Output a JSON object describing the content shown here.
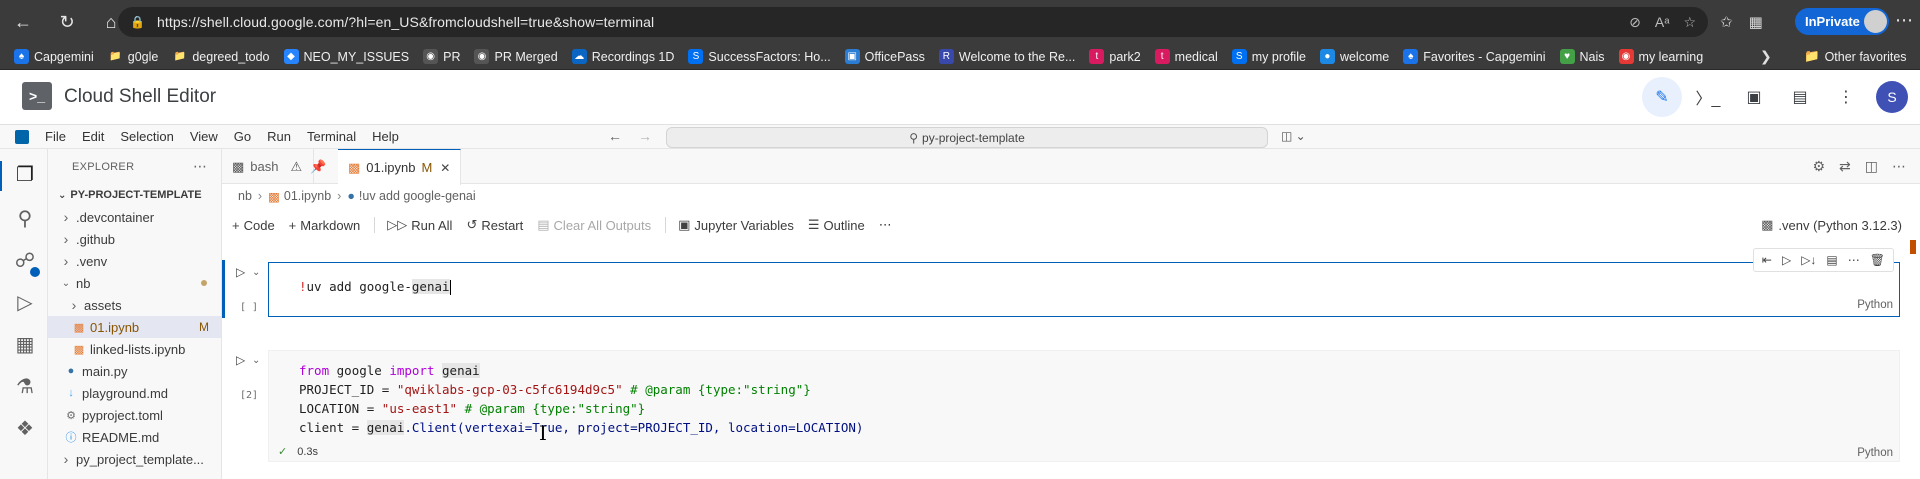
{
  "browser": {
    "url": "https://shell.cloud.google.com/?hl=en_US&fromcloudshell=true&show=terminal",
    "inprivate_label": "InPrivate",
    "bookmarks": [
      {
        "label": "Capgemini",
        "icon": "spade-icon",
        "color": "#1a73e8"
      },
      {
        "label": "g0gle",
        "icon": "folder-icon",
        "color": "#777777"
      },
      {
        "label": "degreed_todo",
        "icon": "folder-icon",
        "color": "#777777"
      },
      {
        "label": "NEO_MY_ISSUES",
        "icon": "diamond-icon",
        "color": "#2684ff"
      },
      {
        "label": "PR",
        "icon": "github-icon",
        "color": "#555555"
      },
      {
        "label": "PR Merged",
        "icon": "github-icon",
        "color": "#555555"
      },
      {
        "label": "Recordings 1D",
        "icon": "cloud-icon",
        "color": "#0a66c2"
      },
      {
        "label": "SuccessFactors: Ho...",
        "icon": "sf-icon",
        "color": "#0070f2"
      },
      {
        "label": "OfficePass",
        "icon": "pass-icon",
        "color": "#2b7cd3"
      },
      {
        "label": "Welcome to the Re...",
        "icon": "r-icon",
        "color": "#3949ab"
      },
      {
        "label": "park2",
        "icon": "t-icon",
        "color": "#d81b60"
      },
      {
        "label": "medical",
        "icon": "t-icon",
        "color": "#d81b60"
      },
      {
        "label": "my profile",
        "icon": "sf-icon",
        "color": "#0070f2"
      },
      {
        "label": "welcome",
        "icon": "globe-icon",
        "color": "#1e88e5"
      },
      {
        "label": "Favorites - Capgemini",
        "icon": "spade-icon",
        "color": "#1a73e8"
      },
      {
        "label": "Nais",
        "icon": "heart-icon",
        "color": "#43a047"
      },
      {
        "label": "my learning",
        "icon": "learning-icon",
        "color": "#e53935"
      }
    ],
    "other_favorites": "Other favorites"
  },
  "cloudshell": {
    "title": "Cloud Shell Editor",
    "avatar_letter": "S"
  },
  "menubar": {
    "items": [
      "File",
      "Edit",
      "Selection",
      "View",
      "Go",
      "Run",
      "Terminal",
      "Help"
    ],
    "search_text": "py-project-template"
  },
  "explorer": {
    "header": "EXPLORER",
    "root": "PY-PROJECT-TEMPLATE",
    "items": [
      {
        "label": ".devcontainer",
        "kind": "folder",
        "indent": 1,
        "expanded": false
      },
      {
        "label": ".github",
        "kind": "folder",
        "indent": 1,
        "expanded": false
      },
      {
        "label": ".venv",
        "kind": "folder",
        "indent": 1,
        "expanded": false
      },
      {
        "label": "nb",
        "kind": "folder",
        "indent": 1,
        "expanded": true,
        "modified_dot": true
      },
      {
        "label": "assets",
        "kind": "folder",
        "indent": 2,
        "expanded": false
      },
      {
        "label": "01.ipynb",
        "kind": "notebook",
        "indent": 2,
        "selected": true,
        "status": "M"
      },
      {
        "label": "linked-lists.ipynb",
        "kind": "notebook",
        "indent": 2
      },
      {
        "label": "main.py",
        "kind": "python",
        "indent": 1
      },
      {
        "label": "playground.md",
        "kind": "markdown",
        "indent": 1
      },
      {
        "label": "pyproject.toml",
        "kind": "toml",
        "indent": 1
      },
      {
        "label": "README.md",
        "kind": "info",
        "indent": 1
      },
      {
        "label": "py_project_template...",
        "kind": "folder",
        "indent": 1,
        "expanded": false
      }
    ]
  },
  "tabs": [
    {
      "label": "bash",
      "icon": "terminal-icon",
      "active": false
    },
    {
      "label": "01.ipynb",
      "icon": "notebook-icon",
      "active": true,
      "status": "M"
    }
  ],
  "breadcrumb": [
    "nb",
    "01.ipynb",
    "!uv add google-genai"
  ],
  "toolbar": {
    "code": "Code",
    "markdown": "Markdown",
    "run_all": "Run All",
    "restart": "Restart",
    "clear_outputs": "Clear All Outputs",
    "variables": "Jupyter Variables",
    "outline": "Outline",
    "kernel": ".venv (Python 3.12.3)"
  },
  "cells": [
    {
      "exec_count": "[ ]",
      "language": "Python",
      "code": "!uv add google-genai"
    },
    {
      "exec_count": "[2]",
      "language": "Python",
      "line1_kw": "from",
      "line1_mod": "google",
      "line1_kw2": "import",
      "line1_name": "genai",
      "line2_var": "PROJECT_ID",
      "line2_str": "\"qwiklabs-gcp-03-c5fc6194d9c5\"",
      "line2_cmt": "# @param {type:\"string\"}",
      "line3_var": "LOCATION",
      "line3_str": "\"us-east1\"",
      "line3_cmt": "# @param {type:\"string\"}",
      "line4_a": "client = ",
      "line4_b": "genai",
      "line4_c": ".Client(vertexai=True, project=PROJECT_ID, location=LOCATION)",
      "duration": "0.3s"
    }
  ]
}
